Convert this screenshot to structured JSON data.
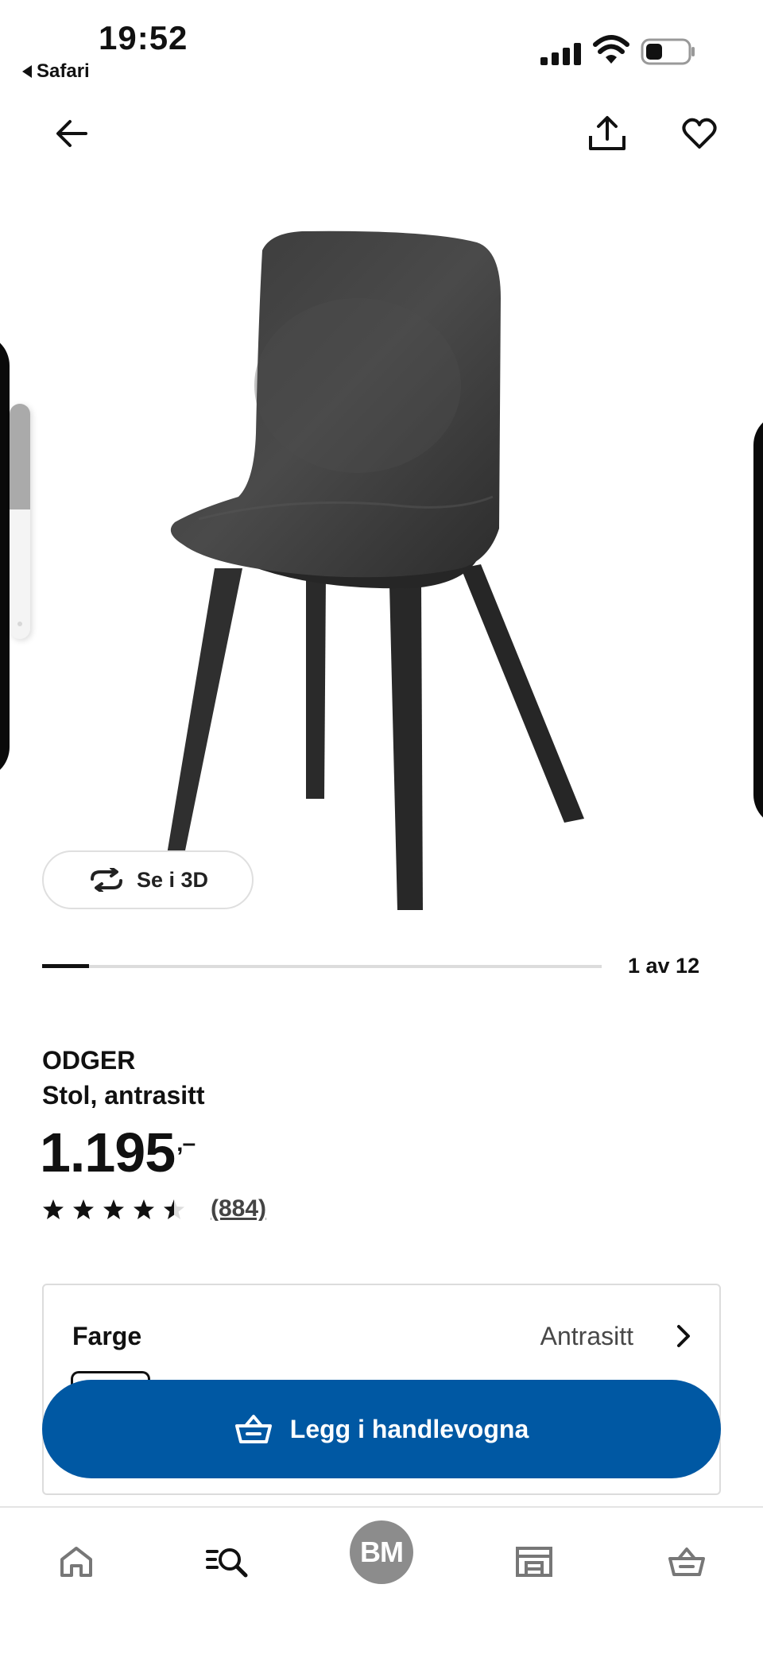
{
  "status_bar": {
    "time": "19:52",
    "back_app": "Safari",
    "battery_level": 0.4
  },
  "header": {
    "back_icon": "arrow-left-icon",
    "share_icon": "share-icon",
    "favorite_icon": "heart-icon"
  },
  "gallery": {
    "view_3d_label": "Se i 3D",
    "view_3d_icon": "rotate-icon",
    "pager_text": "1 av 12",
    "current_index": 1,
    "total": 12,
    "side_slider_level": 0.45
  },
  "product": {
    "name": "ODGER",
    "description": "Stol, antrasitt",
    "price": "1.195",
    "price_suffix": ",–",
    "rating": 4.5,
    "review_count": "(884)"
  },
  "color_selector": {
    "label": "Farge",
    "value": "Antrasitt"
  },
  "cta": {
    "label": "Legg i handlevogna",
    "icon": "basket-icon",
    "color": "#0058a3"
  },
  "bottom_nav": {
    "items": [
      {
        "icon": "home-icon"
      },
      {
        "icon": "search-list-icon"
      },
      {
        "icon": "avatar",
        "initials": "BM"
      },
      {
        "icon": "store-icon"
      },
      {
        "icon": "basket-icon"
      }
    ]
  }
}
